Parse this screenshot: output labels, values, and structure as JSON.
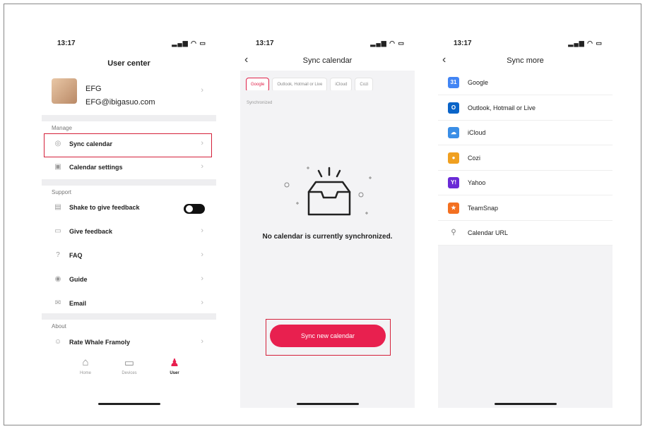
{
  "status": {
    "time": "13:17",
    "icons": "▂▄▆ ◠ ▭"
  },
  "user_center": {
    "title": "User center",
    "profile": {
      "name": "EFG",
      "email": "EFG@ibigasuo.com"
    },
    "manage_label": "Manage",
    "manage_items": [
      {
        "label": "Sync calendar",
        "icon": "calendar-sync-icon",
        "glyph": "◎"
      },
      {
        "label": "Calendar settings",
        "icon": "calendar-icon",
        "glyph": "▣"
      }
    ],
    "support_label": "Support",
    "support_items": [
      {
        "label": "Shake to give feedback",
        "icon": "shake-icon",
        "glyph": "▤",
        "toggle": true
      },
      {
        "label": "Give feedback",
        "icon": "feedback-icon",
        "glyph": "▭"
      },
      {
        "label": "FAQ",
        "icon": "faq-icon",
        "glyph": "?"
      },
      {
        "label": "Guide",
        "icon": "guide-icon",
        "glyph": "◉"
      },
      {
        "label": "Email",
        "icon": "email-icon",
        "glyph": "✉"
      }
    ],
    "about_label": "About",
    "about_items": [
      {
        "label": "Rate Whale Framoly",
        "icon": "rate-icon",
        "glyph": "☺"
      }
    ],
    "tabs": [
      {
        "label": "Home",
        "icon": "home-icon",
        "glyph": "⌂"
      },
      {
        "label": "Devices",
        "icon": "devices-icon",
        "glyph": "▭"
      },
      {
        "label": "User",
        "icon": "user-icon",
        "glyph": "♟"
      }
    ]
  },
  "sync_calendar": {
    "title": "Sync calendar",
    "chips": [
      "Google",
      "Outlook, Hotmail or Live",
      "iCloud",
      "Cozi"
    ],
    "synchronized_label": "Synchronized",
    "empty_text": "No calendar is currently synchronized.",
    "button_label": "Sync new calendar"
  },
  "sync_more": {
    "title": "Sync more",
    "items": [
      {
        "label": "Google",
        "icon": "google-calendar-icon",
        "glyph": "31",
        "color": "#4285f4"
      },
      {
        "label": "Outlook, Hotmail or Live",
        "icon": "outlook-icon",
        "glyph": "O",
        "color": "#0a64c8"
      },
      {
        "label": "iCloud",
        "icon": "icloud-icon",
        "glyph": "☁",
        "color": "#3a8ee6"
      },
      {
        "label": "Cozi",
        "icon": "cozi-icon",
        "glyph": "●",
        "color": "#f0a020"
      },
      {
        "label": "Yahoo",
        "icon": "yahoo-icon",
        "glyph": "Y!",
        "color": "#6a2bd6"
      },
      {
        "label": "TeamSnap",
        "icon": "teamsnap-icon",
        "glyph": "★",
        "color": "#f37021"
      },
      {
        "label": "Calendar URL",
        "icon": "link-icon",
        "glyph": "⚲",
        "color": "#ffffff"
      }
    ]
  },
  "colors": {
    "accent": "#e8204f",
    "highlight": "#d4203a"
  }
}
